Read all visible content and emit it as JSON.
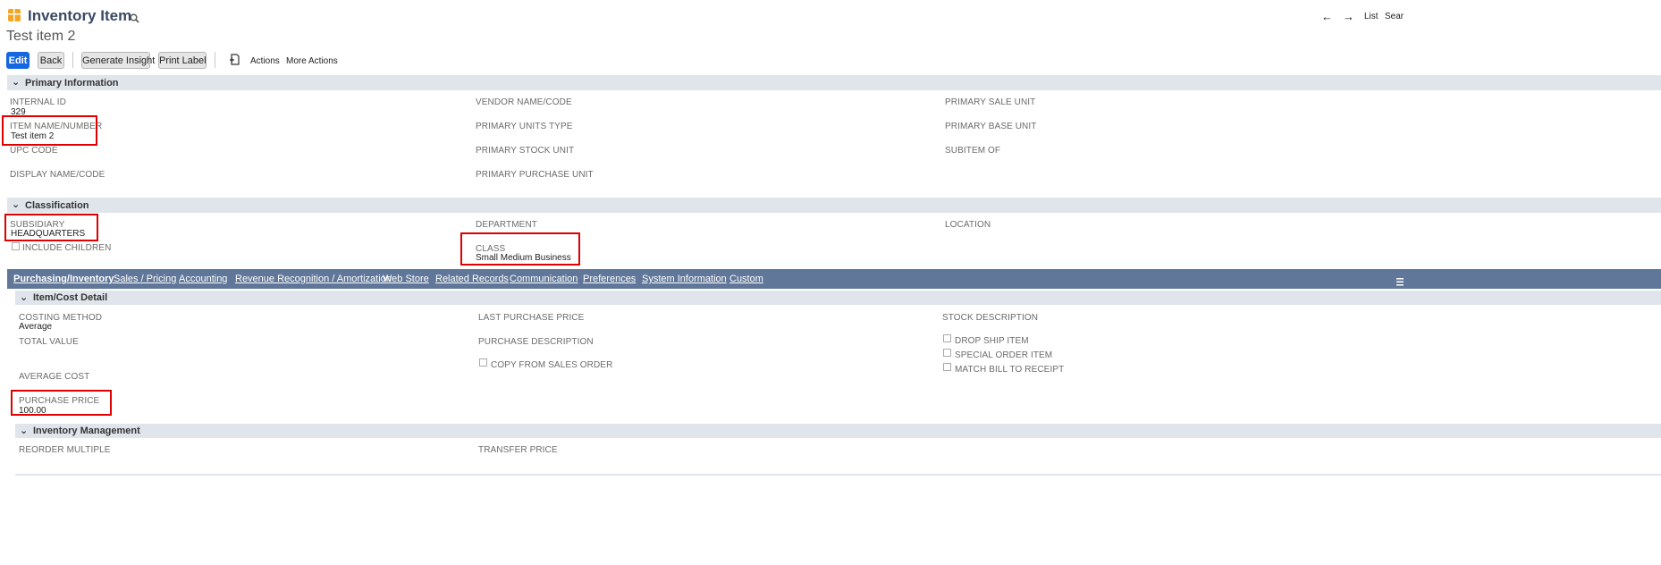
{
  "header": {
    "record_type": "Inventory Item",
    "record_name": "Test item 2",
    "nav": {
      "prev": "←",
      "next": "→",
      "list": "List",
      "search": "Sear"
    }
  },
  "toolbar": {
    "edit": "Edit",
    "back": "Back",
    "generate_insight": "Generate Insight",
    "print_label": "Print Label",
    "actions": "Actions",
    "more_actions": "More Actions"
  },
  "primary": {
    "title": "Primary Information",
    "internal_id_label": "INTERNAL ID",
    "internal_id_value": "329",
    "item_name_label": "ITEM NAME/NUMBER",
    "item_name_value": "Test item 2",
    "upc_label": "UPC CODE",
    "display_name_label": "DISPLAY NAME/CODE",
    "vendor_name_label": "VENDOR NAME/CODE",
    "units_type_label": "PRIMARY UNITS TYPE",
    "stock_unit_label": "PRIMARY STOCK UNIT",
    "purchase_unit_label": "PRIMARY PURCHASE UNIT",
    "sale_unit_label": "PRIMARY SALE UNIT",
    "base_unit_label": "PRIMARY BASE UNIT",
    "subitem_label": "SUBITEM OF"
  },
  "classification": {
    "title": "Classification",
    "subsidiary_label": "SUBSIDIARY",
    "subsidiary_value": "HEADQUARTERS",
    "include_children_label": "INCLUDE CHILDREN",
    "department_label": "DEPARTMENT",
    "class_label": "CLASS",
    "class_value": "Small Medium Business",
    "location_label": "LOCATION"
  },
  "tabs": [
    {
      "label": "Purchasing/Inventory"
    },
    {
      "label": "Sales / Pricing"
    },
    {
      "label": "Accounting"
    },
    {
      "label": "Revenue Recognition / Amortization"
    },
    {
      "label": "Web Store"
    },
    {
      "label": "Related Records"
    },
    {
      "label": "Communication"
    },
    {
      "label": "Preferences"
    },
    {
      "label": "System Information"
    },
    {
      "label": "Custom"
    }
  ],
  "item_cost": {
    "title": "Item/Cost Detail",
    "costing_method_label": "COSTING METHOD",
    "costing_method_value": "Average",
    "total_value_label": "TOTAL VALUE",
    "average_cost_label": "AVERAGE COST",
    "purchase_price_label": "PURCHASE PRICE",
    "purchase_price_value": "100.00",
    "last_purchase_price_label": "LAST PURCHASE PRICE",
    "purchase_description_label": "PURCHASE DESCRIPTION",
    "copy_from_sales_order_label": "COPY FROM SALES ORDER",
    "stock_description_label": "STOCK DESCRIPTION",
    "drop_ship_label": "DROP SHIP ITEM",
    "special_order_label": "SPECIAL ORDER ITEM",
    "match_bill_label": "MATCH BILL TO RECEIPT"
  },
  "inventory_mgmt": {
    "title": "Inventory Management",
    "reorder_multiple_label": "REORDER MULTIPLE",
    "transfer_price_label": "TRANSFER PRICE"
  },
  "colors": {
    "primary_button": "#1467e0",
    "tab_bar": "#607799",
    "section_bar": "#e0e5eb",
    "highlight": "#e00000"
  }
}
